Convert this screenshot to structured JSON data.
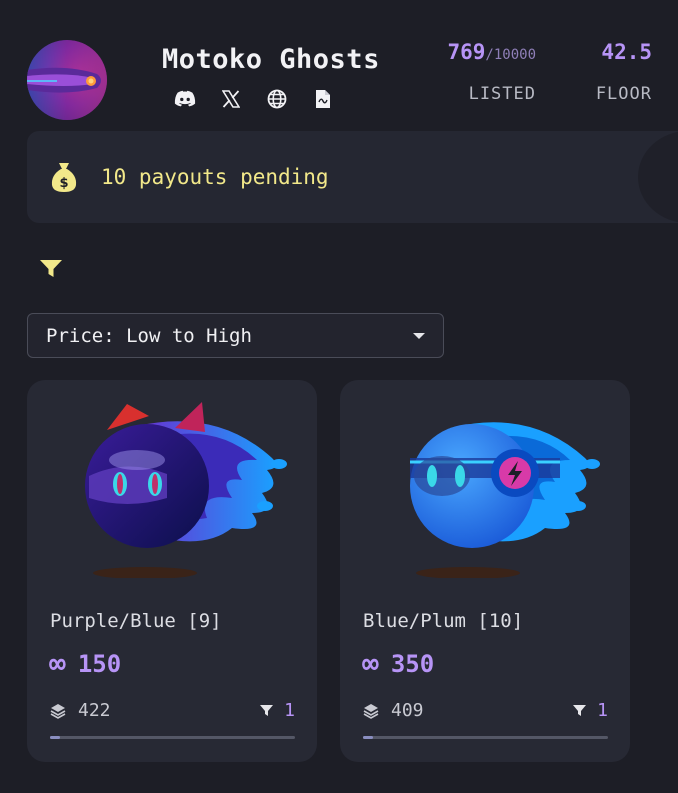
{
  "collection": {
    "title": "Motoko Ghosts",
    "socials": [
      {
        "icon": "discord-icon"
      },
      {
        "icon": "x-icon"
      },
      {
        "icon": "globe-icon"
      },
      {
        "icon": "document-icon"
      }
    ],
    "listed": {
      "count": "769",
      "total": "/10000",
      "label": "LISTED"
    },
    "floor": {
      "value": "42.5",
      "label": "FLOOR"
    }
  },
  "payout": {
    "text": "10 payouts pending",
    "icon": "money-bag-icon"
  },
  "filter": {
    "icon": "filter-icon"
  },
  "sort": {
    "selected": "Price: Low to High"
  },
  "cards": [
    {
      "name": "Purple/Blue [9]",
      "currency_symbol": "∞",
      "price": "150",
      "stat_count": "422",
      "filter_count": "1",
      "progress": 0.04
    },
    {
      "name": "Blue/Plum [10]",
      "currency_symbol": "∞",
      "price": "350",
      "stat_count": "409",
      "filter_count": "1",
      "progress": 0.04
    }
  ],
  "colors": {
    "accent": "#b794f6",
    "payout_text": "#f2e88a",
    "background": "#1d1e26",
    "card": "#272934"
  }
}
